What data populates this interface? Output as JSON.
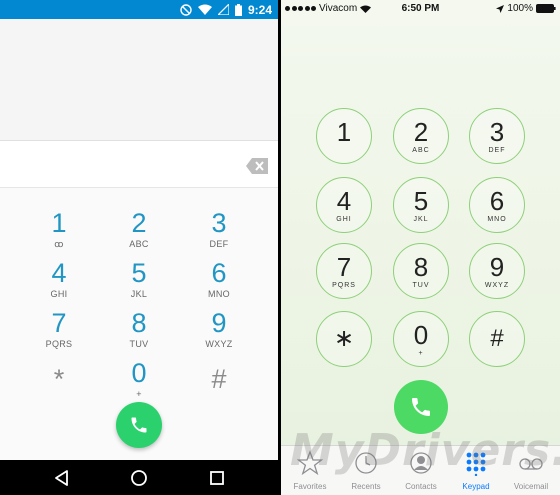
{
  "android": {
    "status_time": "9:24",
    "keys": [
      {
        "digit": "1",
        "letters": "ꝏ",
        "name": "key-1"
      },
      {
        "digit": "2",
        "letters": "ABC",
        "name": "key-2"
      },
      {
        "digit": "3",
        "letters": "DEF",
        "name": "key-3"
      },
      {
        "digit": "4",
        "letters": "GHI",
        "name": "key-4"
      },
      {
        "digit": "5",
        "letters": "JKL",
        "name": "key-5"
      },
      {
        "digit": "6",
        "letters": "MNO",
        "name": "key-6"
      },
      {
        "digit": "7",
        "letters": "PQRS",
        "name": "key-7"
      },
      {
        "digit": "8",
        "letters": "TUV",
        "name": "key-8"
      },
      {
        "digit": "9",
        "letters": "WXYZ",
        "name": "key-9"
      },
      {
        "digit": "*",
        "letters": "",
        "name": "key-star"
      },
      {
        "digit": "0",
        "letters": "+",
        "name": "key-0"
      },
      {
        "digit": "#",
        "letters": "",
        "name": "key-hash"
      }
    ],
    "icons": {
      "dnd": "do-not-disturb-icon",
      "wifi": "wifi-icon",
      "signal": "signal-icon",
      "battery": "battery-icon"
    },
    "accent": "#0288d1",
    "call_color": "#2bd16d"
  },
  "ios": {
    "carrier": "Vivacom",
    "time": "6:50 PM",
    "battery": "100%",
    "keys": [
      {
        "digit": "1",
        "letters": "",
        "name": "key-1"
      },
      {
        "digit": "2",
        "letters": "ABC",
        "name": "key-2"
      },
      {
        "digit": "3",
        "letters": "DEF",
        "name": "key-3"
      },
      {
        "digit": "4",
        "letters": "GHI",
        "name": "key-4"
      },
      {
        "digit": "5",
        "letters": "JKL",
        "name": "key-5"
      },
      {
        "digit": "6",
        "letters": "MNO",
        "name": "key-6"
      },
      {
        "digit": "7",
        "letters": "PQRS",
        "name": "key-7"
      },
      {
        "digit": "8",
        "letters": "TUV",
        "name": "key-8"
      },
      {
        "digit": "9",
        "letters": "WXYZ",
        "name": "key-9"
      },
      {
        "digit": "∗",
        "letters": "",
        "name": "key-star"
      },
      {
        "digit": "0",
        "letters": "+",
        "name": "key-0"
      },
      {
        "digit": "#",
        "letters": "",
        "name": "key-hash"
      }
    ],
    "tabs": [
      {
        "label": "Favorites",
        "icon": "star-icon",
        "name": "tab-favorites"
      },
      {
        "label": "Recents",
        "icon": "clock-icon",
        "name": "tab-recents"
      },
      {
        "label": "Contacts",
        "icon": "contacts-icon",
        "name": "tab-contacts"
      },
      {
        "label": "Keypad",
        "icon": "keypad-icon",
        "name": "tab-keypad",
        "active": true
      },
      {
        "label": "Voicemail",
        "icon": "voicemail-icon",
        "name": "tab-voicemail"
      }
    ],
    "key_border_color": "#8ed07a",
    "call_color": "#4cd964",
    "active_tab_color": "#0a7aff"
  },
  "watermark": "MyDrivers.com"
}
